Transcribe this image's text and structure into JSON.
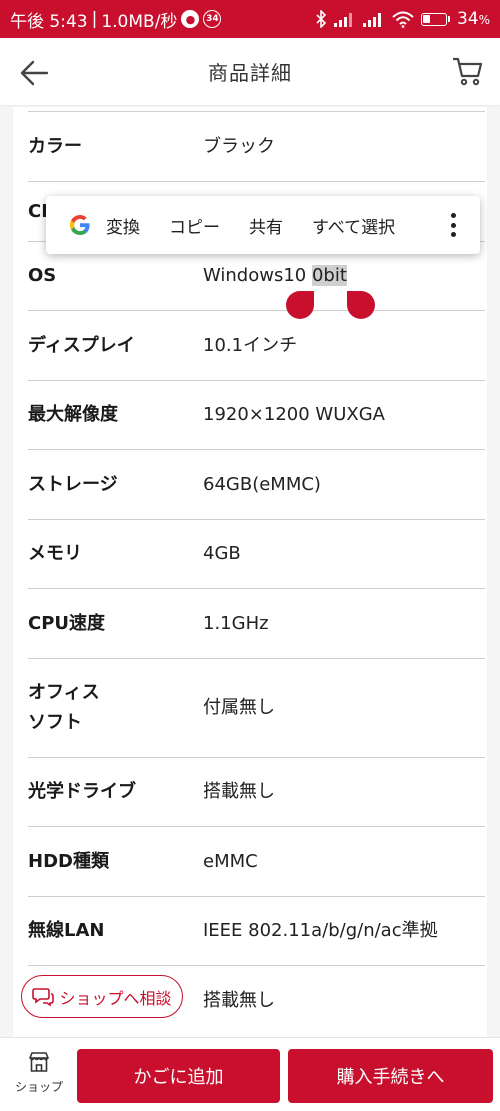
{
  "status": {
    "time": "午後 5:43",
    "separator": "|",
    "speed": "1.0MB/秒",
    "notif_count": "34",
    "battery": "34",
    "battery_unit": "%"
  },
  "header": {
    "title": "商品詳細"
  },
  "specs": [
    {
      "label": "カラー",
      "value": "ブラック"
    },
    {
      "label": "CI",
      "value": ""
    },
    {
      "label": "OS",
      "value_main": "Windows10 ",
      "value_selected": "0bit"
    },
    {
      "label": "ディスプレイ",
      "value": "10.1インチ"
    },
    {
      "label": "最大解像度",
      "value": "1920×1200 WUXGA"
    },
    {
      "label": "ストレージ",
      "value": "64GB(eMMC)"
    },
    {
      "label": "メモリ",
      "value": "4GB"
    },
    {
      "label": "CPU速度",
      "value": "1.1GHz"
    },
    {
      "label_line1": "オフィス",
      "label_line2": "ソフト",
      "value": "付属無し"
    },
    {
      "label": "光学ドライブ",
      "value": "搭載無し"
    },
    {
      "label": "HDD種類",
      "value": "eMMC"
    },
    {
      "label": "無線LAN",
      "value": "IEEE 802.11a/b/g/n/ac準拠"
    },
    {
      "label": "",
      "value": "搭載無し"
    }
  ],
  "context_menu": {
    "items": [
      "変換",
      "コピー",
      "共有",
      "すべて選択"
    ]
  },
  "consult": {
    "label": "ショップへ相談"
  },
  "bottom": {
    "shop_label": "ショップ",
    "add_to_cart": "かごに追加",
    "checkout": "購入手続きへ"
  },
  "colors": {
    "brand": "#c8102e",
    "selection": "#cfcfcf"
  },
  "icons": {
    "back": "arrow-left",
    "cart": "shopping-cart",
    "shop": "storefront",
    "chat": "chat-bubble",
    "google": "google-g",
    "more": "vertical-dots"
  }
}
